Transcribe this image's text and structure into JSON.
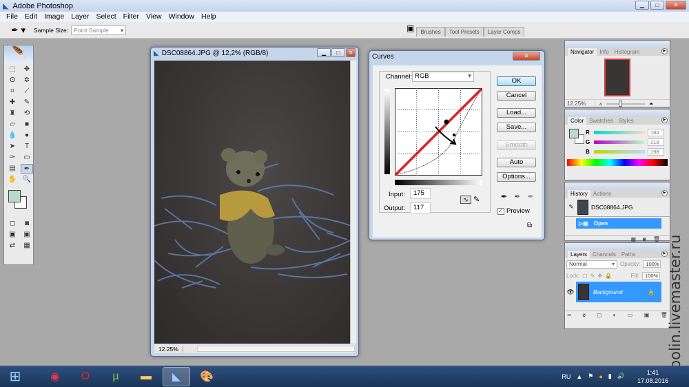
{
  "app": {
    "title": "Adobe Photoshop"
  },
  "menu": [
    "File",
    "Edit",
    "Image",
    "Layer",
    "Select",
    "Filter",
    "View",
    "Window",
    "Help"
  ],
  "options": {
    "sample_size_label": "Sample Size:",
    "sample_size_value": "Point Sample"
  },
  "well_tabs": [
    "Brushes",
    "Tool Presets",
    "Layer Comps"
  ],
  "document": {
    "title": "DSC08864.JPG @ 12,2% (RGB/8)",
    "zoom": "12.25%"
  },
  "curves": {
    "title": "Curves",
    "channel_label": "Channel:",
    "channel_value": "RGB",
    "input_label": "Input:",
    "input_value": "175",
    "output_label": "Output:",
    "output_value": "117",
    "buttons": [
      "OK",
      "Cancel",
      "Load...",
      "Save...",
      "Smooth",
      "Auto",
      "Options..."
    ],
    "preview_label": "Preview",
    "preview_checked": true,
    "curve_color": "#e02020"
  },
  "navigator": {
    "tabs": [
      "Navigator",
      "Info",
      "Histogram"
    ],
    "zoom": "12.25%"
  },
  "color": {
    "tabs": [
      "Color",
      "Swatches",
      "Styles"
    ],
    "channels": [
      {
        "label": "R",
        "value": "184"
      },
      {
        "label": "G",
        "value": "218"
      },
      {
        "label": "B",
        "value": "198"
      }
    ],
    "foreground": "#b8dac6"
  },
  "history": {
    "tabs": [
      "History",
      "Actions"
    ],
    "snapshot": "DSC08864.JPG",
    "items": [
      "Open"
    ]
  },
  "layers": {
    "tabs": [
      "Layers",
      "Channels",
      "Paths"
    ],
    "blend_mode": "Normal",
    "opacity_label": "Opacity:",
    "opacity": "100%",
    "lock_label": "Lock:",
    "fill_label": "Fill:",
    "fill": "100%",
    "items": [
      "Background"
    ]
  },
  "taskbar": {
    "lang": "RU",
    "time": "1:41",
    "date": "17.08.2016"
  },
  "watermark": "sobolin.livemaster.ru"
}
